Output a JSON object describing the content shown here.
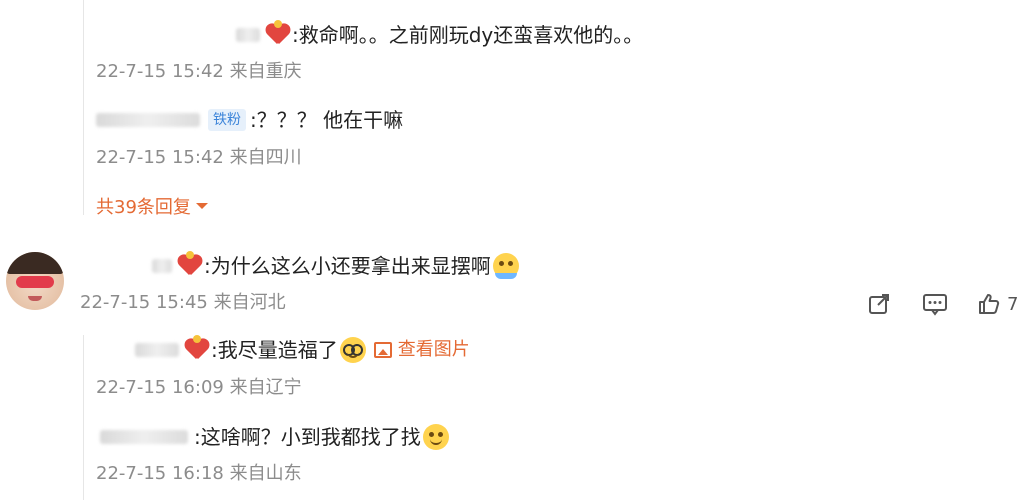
{
  "replies_top": [
    {
      "text": ":救命啊。。之前刚玩dy还蛮喜欢他的。。",
      "meta": "22-7-15 15:42 来自重庆"
    },
    {
      "badge": "铁粉",
      "text": ":？？？ 他在干嘛",
      "meta": "22-7-15 15:42 来自四川"
    }
  ],
  "more_replies": "共39条回复",
  "main_comment": {
    "text": ":为什么这么小还要拿出来显摆啊",
    "meta": "22-7-15 15:45 来自河北",
    "like_count": "7"
  },
  "replies_bottom": [
    {
      "text": ":我尽量造福了",
      "link": "查看图片",
      "meta": "22-7-15 16:09 来自辽宁"
    },
    {
      "text": ":这啥啊？小到我都找了找",
      "meta": "22-7-15 16:18 来自山东"
    }
  ],
  "colors": {
    "accent": "#e46a34",
    "meta": "#8c8c8c",
    "badge": "#3c84d9"
  }
}
